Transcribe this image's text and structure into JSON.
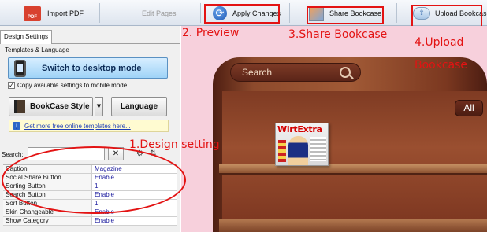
{
  "toolbar": {
    "import_pdf": "Import PDF",
    "edit_pages": "Edit Pages",
    "apply_changes": "Apply Changes",
    "share_bookcase": "Share Bookcase",
    "upload_bookcase": "Upload Bookcase",
    "pdf_icon_text": "PDF"
  },
  "annotations": {
    "preview": "2. Preview",
    "share": "3.Share Bookcase",
    "upload_line1": "4.Upload",
    "upload_line2": "Bookcase",
    "design": "1.Design setting",
    "color": "#e31313"
  },
  "panel": {
    "tab": "Design Settings",
    "section": "Templates & Language",
    "switch_button": "Switch to desktop mode",
    "copy_checkbox": "Copy available settings to mobile mode",
    "copy_checked": true,
    "style_button": "BookCase Style",
    "language_button": "Language",
    "template_link": "Get more free online templates here...",
    "search_label": "Search:",
    "search_value": "",
    "properties": [
      {
        "key": "Caption",
        "value": "Magazine"
      },
      {
        "key": "Social Share Button",
        "value": "Enable"
      },
      {
        "key": "Sorting Button",
        "value": "1"
      },
      {
        "key": "Search Button",
        "value": "Enable"
      },
      {
        "key": "Sort Button",
        "value": "1"
      },
      {
        "key": "Skin Changeable",
        "value": "Enable"
      },
      {
        "key": "Show Category",
        "value": "Enable"
      }
    ]
  },
  "preview": {
    "search_placeholder": "Search",
    "category_button": "All",
    "book_title": "WirtExtra",
    "background": "#f7d0dc"
  },
  "icons": [
    "pdf-icon",
    "refresh-icon",
    "share-icon",
    "upload-icon",
    "phone-icon",
    "book-icon",
    "info-icon",
    "search-icon",
    "close-icon",
    "filter-icon",
    "sort-icon",
    "chevron-down-icon"
  ]
}
